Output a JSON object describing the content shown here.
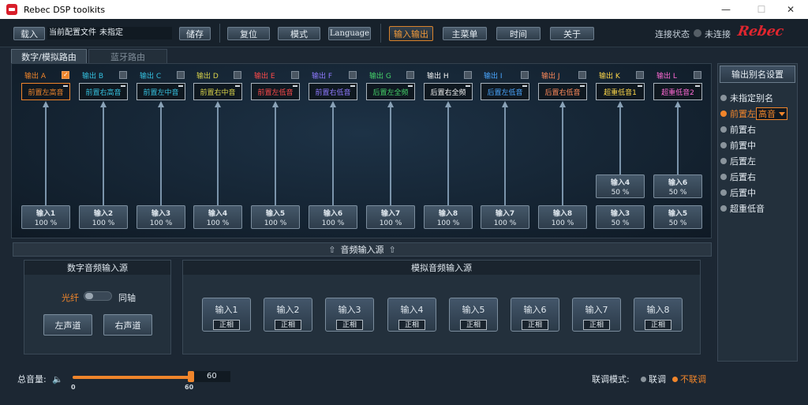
{
  "window": {
    "title": "Rebec DSP toolkits",
    "controls": [
      "—",
      "☐",
      "✕"
    ]
  },
  "toolbar": {
    "load": "载入",
    "file_label": "当前配置文件",
    "file_value": "未指定",
    "save": "储存",
    "reset": "复位",
    "mode": "模式",
    "language": "Language",
    "io": "输入输出",
    "main_menu": "主菜单",
    "time": "时间",
    "about": "关于",
    "conn_label": "连接状态",
    "conn_value": "未连接",
    "brand": "Rebec"
  },
  "tabs": [
    {
      "label": "数字/模拟路由",
      "active": true
    },
    {
      "label": "蓝牙路由",
      "active": false
    }
  ],
  "outputs": [
    {
      "head": "输出 A",
      "name": "前置左高音",
      "color": "#f0852b",
      "checked": true
    },
    {
      "head": "输出 B",
      "name": "前置右高音",
      "color": "#35c2e0",
      "checked": false
    },
    {
      "head": "输出 C",
      "name": "前置左中音",
      "color": "#35c2e0",
      "checked": false
    },
    {
      "head": "输出 D",
      "name": "前置右中音",
      "color": "#d8d24a",
      "checked": false
    },
    {
      "head": "输出 E",
      "name": "前置左低音",
      "color": "#ff4a4a",
      "checked": false
    },
    {
      "head": "输出 F",
      "name": "前置右低音",
      "color": "#8f7aff",
      "checked": false
    },
    {
      "head": "输出 G",
      "name": "后置左全频",
      "color": "#45d36a",
      "checked": false
    },
    {
      "head": "输出 H",
      "name": "后置右全频",
      "color": "#f3f3f3",
      "checked": false
    },
    {
      "head": "输出 I",
      "name": "后置左低音",
      "color": "#4aa6ff",
      "checked": false
    },
    {
      "head": "输出 J",
      "name": "后置右低音",
      "color": "#ff8a5a",
      "checked": false
    },
    {
      "head": "输出 K",
      "name": "超重低音1",
      "color": "#ffd84a",
      "checked": false
    },
    {
      "head": "输出 L",
      "name": "超重低音2",
      "color": "#ff6ad5",
      "checked": false
    }
  ],
  "inputs_lower": [
    {
      "name": "输入1",
      "value": "100 %"
    },
    {
      "name": "输入2",
      "value": "100 %"
    },
    {
      "name": "输入3",
      "value": "100 %"
    },
    {
      "name": "输入4",
      "value": "100 %"
    },
    {
      "name": "输入5",
      "value": "100 %"
    },
    {
      "name": "输入6",
      "value": "100 %"
    },
    {
      "name": "输入7",
      "value": "100 %"
    },
    {
      "name": "输入8",
      "value": "100 %"
    },
    {
      "name": "输入7",
      "value": "100 %"
    },
    {
      "name": "输入8",
      "value": "100 %"
    },
    {
      "name": "输入3",
      "value": "50 %"
    },
    {
      "name": "输入5",
      "value": "50 %"
    }
  ],
  "inputs_upper": [
    {
      "name": "输入4",
      "value": "50 %"
    },
    {
      "name": "输入6",
      "value": "50 %"
    }
  ],
  "source_bar": "音频输入源",
  "digital": {
    "title": "数字音频输入源",
    "optical": "光纤",
    "coax": "同轴",
    "left": "左声道",
    "right": "右声道"
  },
  "analog": {
    "title": "模拟音频输入源",
    "inputs": [
      "输入1",
      "输入2",
      "输入3",
      "输入4",
      "输入5",
      "输入6",
      "输入7",
      "输入8"
    ],
    "phase": "正相"
  },
  "alias": {
    "title": "输出别名设置",
    "items": [
      "未指定别名",
      "前置左",
      "前置右",
      "前置中",
      "后置左",
      "后置右",
      "后置中",
      "超重低音"
    ],
    "selected_index": 1,
    "select_value": "高音"
  },
  "volume": {
    "label": "总音量:",
    "value": "60",
    "min": "0",
    "max": "60",
    "level": 1.0
  },
  "link_mode": {
    "label": "联调模式:",
    "linked": "联调",
    "unlinked": "不联调",
    "accent": "#f0852b"
  }
}
